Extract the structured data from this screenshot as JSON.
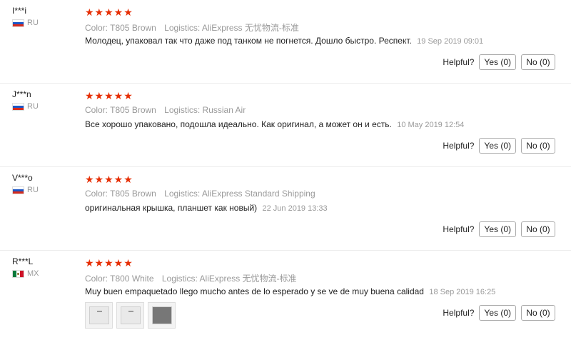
{
  "helpful_label": "Helpful?",
  "reviews": [
    {
      "user": "I***i",
      "country": "RU",
      "stars": "★★★★★",
      "color": "Color: T805 Brown",
      "logistics": "Logistics: AliExpress 无忧物流-标准",
      "text": "Молодец, упаковал так что даже под танком не погнется. Дошло быстро. Респект.",
      "date": "19 Sep 2019 09:01",
      "yes": "Yes (0)",
      "no": "No (0)"
    },
    {
      "user": "J***n",
      "country": "RU",
      "stars": "★★★★★",
      "color": "Color: T805 Brown",
      "logistics": "Logistics: Russian Air",
      "text": "Все хорошо упаковано, подошла идеально. Как оригинал, а может он и есть.",
      "date": "10 May 2019 12:54",
      "yes": "Yes (0)",
      "no": "No (0)"
    },
    {
      "user": "V***o",
      "country": "RU",
      "stars": "★★★★★",
      "color": "Color: T805 Brown",
      "logistics": "Logistics: AliExpress Standard Shipping",
      "text": "оригинальная крышка, планшет как новый)",
      "date": "22 Jun 2019 13:33",
      "yes": "Yes (0)",
      "no": "No (0)"
    },
    {
      "user": "R***L",
      "country": "MX",
      "stars": "★★★★★",
      "color": "Color: T800 White",
      "logistics": "Logistics: AliExpress 无忧物流-标准",
      "text": "Muy buen empaquetado llego mucho antes de lo esperado y se ve de muy buena calidad",
      "date": "18 Sep 2019 16:25",
      "yes": "Yes (0)",
      "no": "No (0)"
    }
  ]
}
